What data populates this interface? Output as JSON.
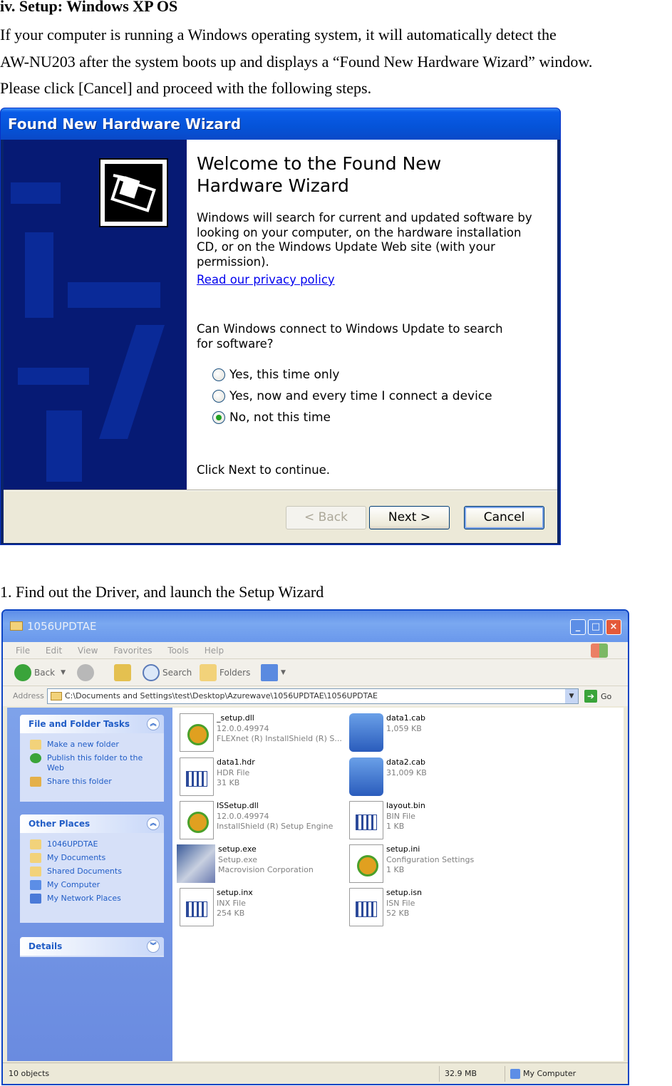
{
  "doc": {
    "heading": "iv. Setup: Windows XP OS",
    "para_lines": [
      "If your computer is running a Windows operating system, it will automatically detect the",
      "AW-NU203 after the system boots up and displays a “Found New Hardware Wizard” window.",
      "Please click [Cancel] and proceed with the following steps."
    ],
    "step1": "1. Find out the Driver, and launch the Setup Wizard"
  },
  "wizard": {
    "title": "Found New Hardware Wizard",
    "heading": "Welcome to the Found New Hardware Wizard",
    "description": "Windows will search for current and updated software by looking on your computer, on the hardware installation CD, or on the Windows Update Web site (with your permission).",
    "privacy_link": "Read our privacy policy",
    "question": "Can Windows connect to Windows Update to search for software?",
    "options": [
      {
        "label": "Yes, this time only",
        "selected": false
      },
      {
        "label": "Yes, now and every time I connect a device",
        "selected": false
      },
      {
        "label": "No, not this time",
        "selected": true
      }
    ],
    "continue_text": "Click Next to continue.",
    "buttons": {
      "back": "< Back",
      "next": "Next >",
      "cancel": "Cancel"
    }
  },
  "explorer": {
    "title": "1056UPDTAE",
    "menu": [
      "File",
      "Edit",
      "View",
      "Favorites",
      "Tools",
      "Help"
    ],
    "toolbar": {
      "back": "Back",
      "search": "Search",
      "folders": "Folders"
    },
    "address_label": "Address",
    "address_value": "C:\\Documents and Settings\\test\\Desktop\\Azurewave\\1056UPDTAE\\1056UPDTAE",
    "go": "Go",
    "panels": {
      "tasks": {
        "title": "File and Folder Tasks",
        "items": [
          "Make a new folder",
          "Publish this folder to the Web",
          "Share this folder"
        ]
      },
      "places": {
        "title": "Other Places",
        "items": [
          "1046UPDTAE",
          "My Documents",
          "Shared Documents",
          "My Computer",
          "My Network Places"
        ]
      },
      "details": {
        "title": "Details"
      }
    },
    "files": [
      {
        "name": "_setup.dll",
        "line2": "12.0.0.49974",
        "line3": "FLEXnet (R) InstallShield (R) S...",
        "icon": "gear-file-icon"
      },
      {
        "name": "data1.cab",
        "line2": "1,059 KB",
        "line3": "",
        "icon": "cabinet-icon"
      },
      {
        "name": "data1.hdr",
        "line2": "HDR File",
        "line3": "31 KB",
        "icon": "document-icon"
      },
      {
        "name": "data2.cab",
        "line2": "31,009 KB",
        "line3": "",
        "icon": "cabinet-icon"
      },
      {
        "name": "ISSetup.dll",
        "line2": "12.0.0.49974",
        "line3": "InstallShield (R) Setup Engine",
        "icon": "gear-file-icon"
      },
      {
        "name": "layout.bin",
        "line2": "BIN File",
        "line3": "1 KB",
        "icon": "document-icon"
      },
      {
        "name": "setup.exe",
        "line2": "Setup.exe",
        "line3": "Macrovision Corporation",
        "icon": "setup-exe-icon"
      },
      {
        "name": "setup.ini",
        "line2": "Configuration Settings",
        "line3": "1 KB",
        "icon": "gear-file-icon"
      },
      {
        "name": "setup.inx",
        "line2": "INX File",
        "line3": "254 KB",
        "icon": "document-icon"
      },
      {
        "name": "setup.isn",
        "line2": "ISN File",
        "line3": "52 KB",
        "icon": "document-icon"
      }
    ],
    "status": {
      "objects": "10 objects",
      "size": "32.9 MB",
      "location": "My Computer"
    }
  }
}
